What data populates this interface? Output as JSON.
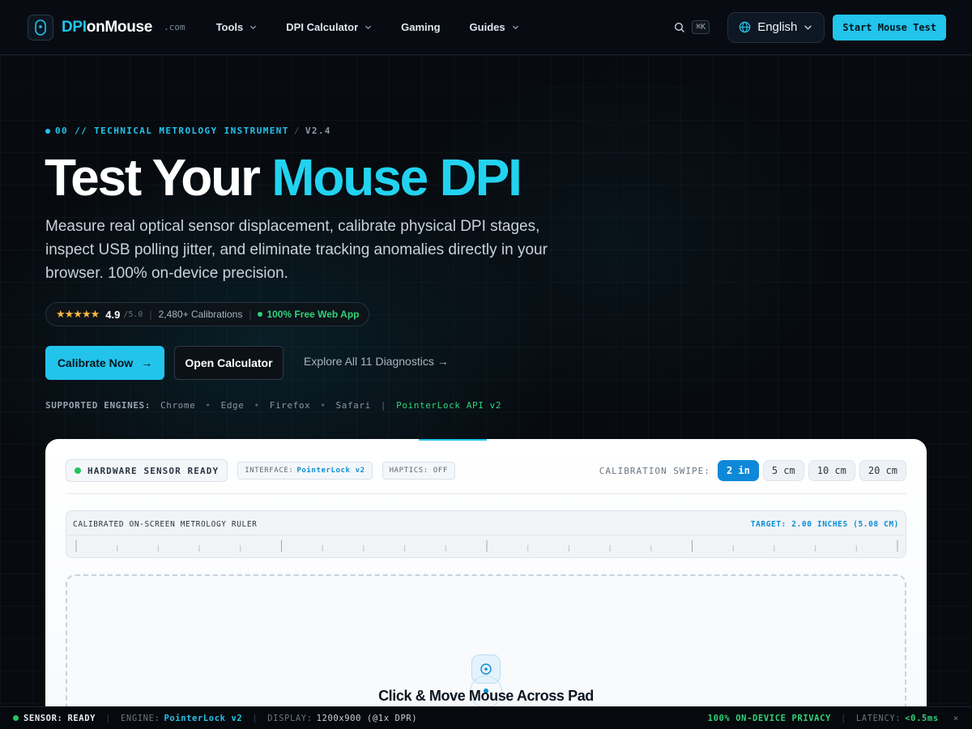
{
  "brand": {
    "name_accent": "DPI",
    "name_rest": "onMouse",
    "tld": ".com"
  },
  "nav": {
    "items": [
      {
        "label": "Tools",
        "has_dropdown": true
      },
      {
        "label": "DPI Calculator",
        "has_dropdown": true
      },
      {
        "label": "Gaming",
        "has_dropdown": false
      },
      {
        "label": "Guides",
        "has_dropdown": true
      }
    ],
    "search_shortcut": "⌘K",
    "language": "English",
    "start_button": "Start Mouse Test"
  },
  "hero": {
    "eyebrow": "00 // TECHNICAL METROLOGY INSTRUMENT",
    "eyebrow_sep": "/",
    "version": "V2.4",
    "title_plain": "Test Your ",
    "title_accent": "Mouse DPI",
    "subtitle": "Measure real optical sensor displacement, calibrate physical DPI stages, inspect USB polling jitter, and eliminate tracking anomalies directly in your browser. 100% on-device precision.",
    "rating": {
      "stars": "★★★★★",
      "score": "4.9",
      "out_of": "/5.0",
      "calibrations": "2,480+ Calibrations",
      "free_label": "100% Free Web App"
    },
    "cta_primary": "Calibrate Now",
    "cta_primary_arrow": "→",
    "cta_secondary": "Open Calculator",
    "cta_link": "Explore All 11 Diagnostics →",
    "engines": {
      "label": "SUPPORTED ENGINES:",
      "list": [
        "Chrome",
        "Edge",
        "Firefox",
        "Safari"
      ],
      "bullet": "•",
      "api": "PointerLock API v2"
    }
  },
  "tester": {
    "status_label": "HARDWARE SENSOR READY",
    "interface_key": "INTERFACE:",
    "interface_value": "PointerLock v2",
    "haptics": "HAPTICS: OFF",
    "swipe_label": "CALIBRATION SWIPE:",
    "swipe_options": [
      "2 in",
      "5 cm",
      "10 cm",
      "20 cm"
    ],
    "swipe_selected": "2 in",
    "ruler_label": "CALIBRATED ON-SCREEN METROLOGY RULER",
    "ruler_target": "TARGET: 2.00 INCHES (5.08 CM)",
    "pad_prompt": "Click & Move Mouse Across Pad"
  },
  "statusbar": {
    "sensor_key": "SENSOR:",
    "sensor_value": "READY",
    "engine_key": "ENGINE:",
    "engine_value": "PointerLock v2",
    "display_key": "DISPLAY:",
    "display_value": "1200x900 (@1x DPR)",
    "privacy": "100% ON-DEVICE PRIVACY",
    "latency_key": "LATENCY:",
    "latency_value": "<0.5ms",
    "close": "×"
  },
  "colors": {
    "accent": "#22c4ec",
    "success": "#30d37a",
    "active_option": "#0e88d8",
    "star": "#f6b73c"
  }
}
